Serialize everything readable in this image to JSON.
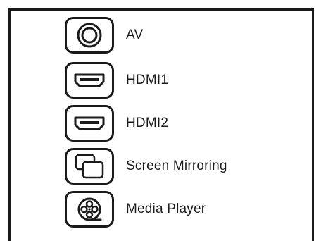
{
  "menu": {
    "items": [
      {
        "label": "AV",
        "icon": "av-composite-icon"
      },
      {
        "label": "HDMI1",
        "icon": "hdmi-port-icon"
      },
      {
        "label": "HDMI2",
        "icon": "hdmi-port-icon"
      },
      {
        "label": "Screen Mirroring",
        "icon": "screen-mirroring-icon"
      },
      {
        "label": "Media Player",
        "icon": "film-reel-icon"
      }
    ]
  },
  "colors": {
    "stroke": "#1a1a1a",
    "background": "#ffffff"
  }
}
